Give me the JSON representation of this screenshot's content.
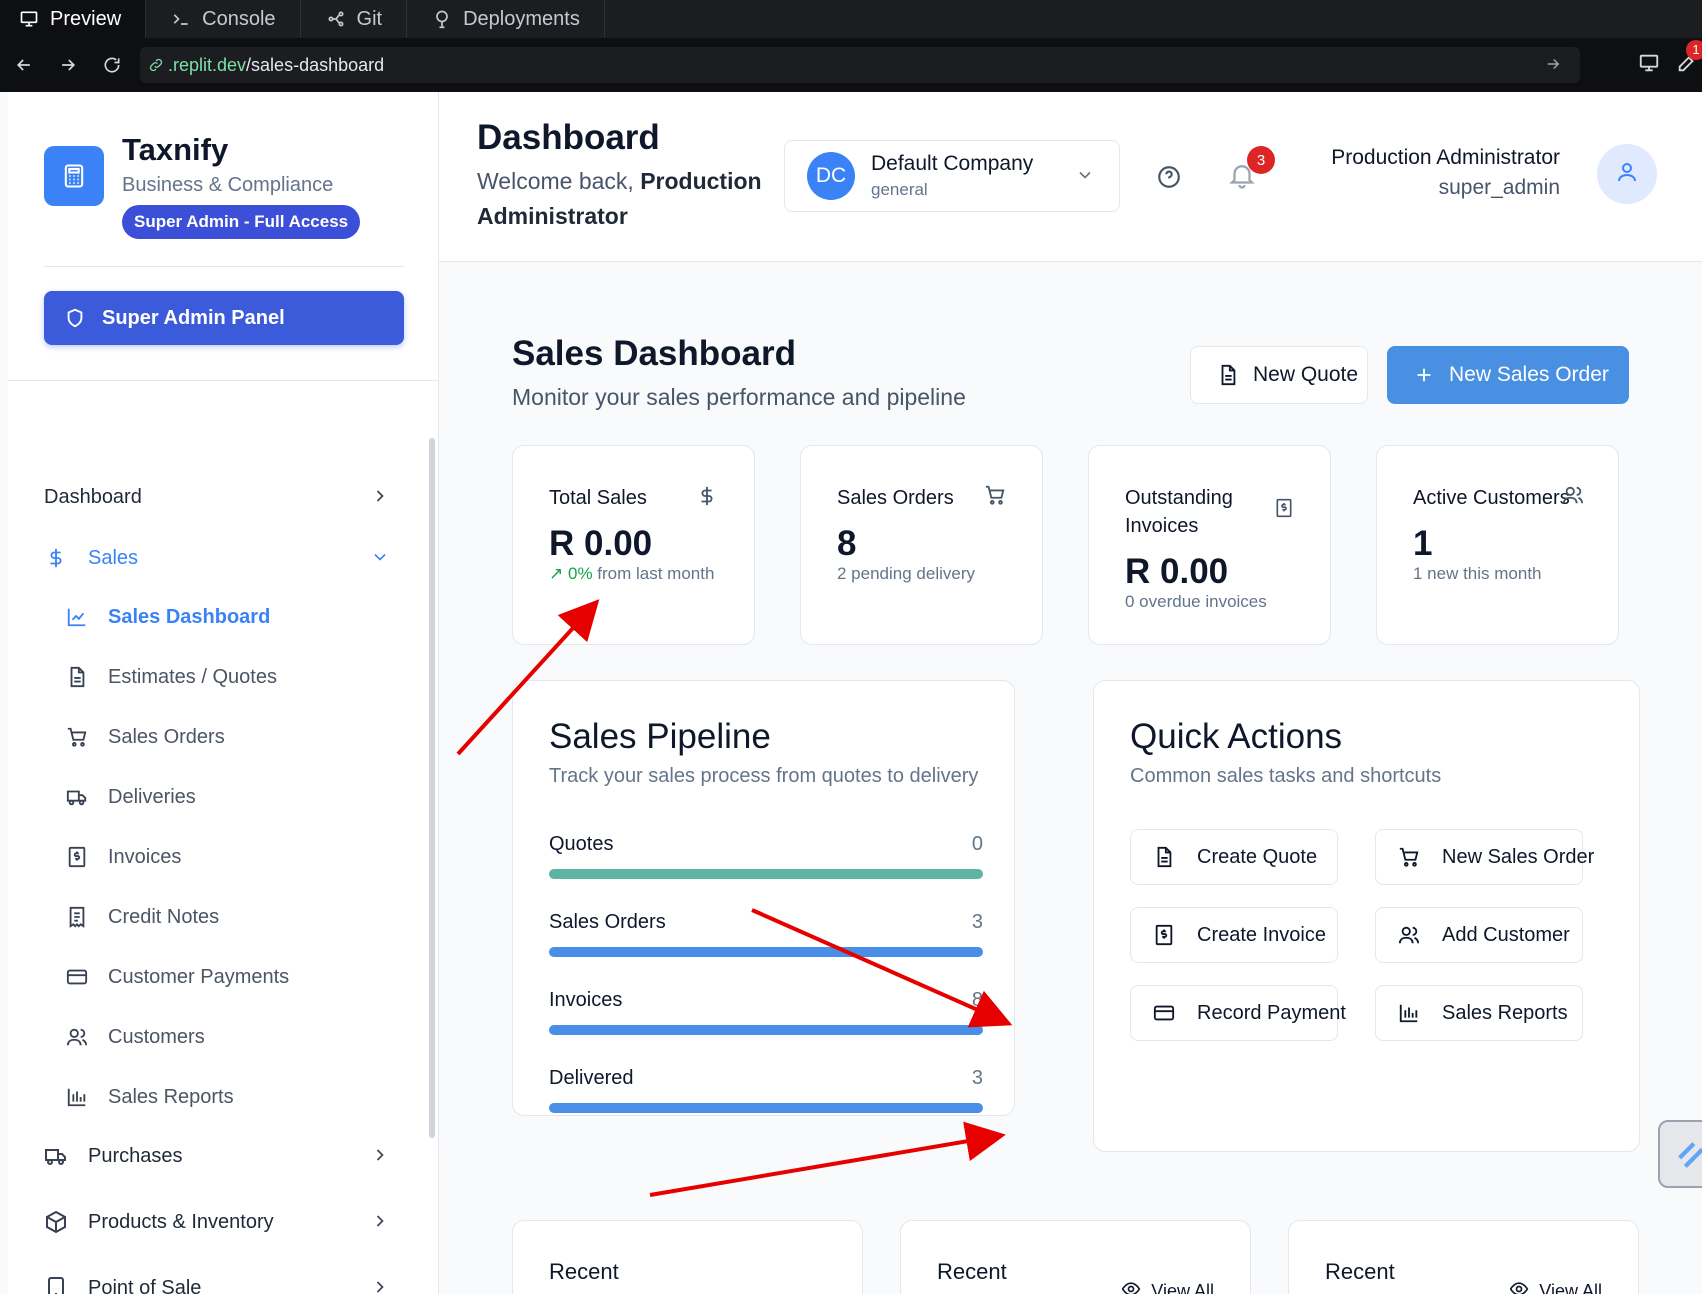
{
  "browser": {
    "tabs": [
      {
        "label": "Preview",
        "icon": "monitor-icon"
      },
      {
        "label": "Console",
        "icon": "terminal-icon"
      },
      {
        "label": "Git",
        "icon": "git-icon"
      },
      {
        "label": "Deployments",
        "icon": "deployments-icon"
      }
    ],
    "url_domain": ".replit.dev",
    "url_path": "/sales-dashboard",
    "notification_count": "1"
  },
  "sidebar": {
    "brand_title": "Taxnify",
    "brand_subtitle": "Business & Compliance",
    "access_badge": "Super Admin - Full Access",
    "admin_panel_label": "Super Admin Panel",
    "nav": [
      {
        "label": "Dashboard",
        "expanded": false
      },
      {
        "label": "Sales",
        "expanded": true
      },
      {
        "label": "Purchases",
        "expanded": false
      },
      {
        "label": "Products & Inventory",
        "expanded": false
      },
      {
        "label": "Point of Sale",
        "expanded": false
      }
    ],
    "sales_items": [
      {
        "label": "Sales Dashboard",
        "icon": "line-chart-icon",
        "active": true
      },
      {
        "label": "Estimates / Quotes",
        "icon": "document-icon"
      },
      {
        "label": "Sales Orders",
        "icon": "cart-icon"
      },
      {
        "label": "Deliveries",
        "icon": "truck-icon"
      },
      {
        "label": "Invoices",
        "icon": "invoice-icon"
      },
      {
        "label": "Credit Notes",
        "icon": "receipt-icon"
      },
      {
        "label": "Customer Payments",
        "icon": "credit-card-icon"
      },
      {
        "label": "Customers",
        "icon": "users-icon"
      },
      {
        "label": "Sales Reports",
        "icon": "bar-chart-icon"
      }
    ]
  },
  "header": {
    "title": "Dashboard",
    "welcome_prefix": "Welcome back, ",
    "welcome_name": "Production Administrator",
    "company_initials": "DC",
    "company_name": "Default Company",
    "company_type": "general",
    "notifications": "3",
    "user_name": "Production Administrator",
    "user_role": "super_admin"
  },
  "main": {
    "title": "Sales Dashboard",
    "subtitle": "Monitor your sales performance and pipeline",
    "new_quote_label": "New Quote",
    "new_order_label": "New Sales Order",
    "stats": [
      {
        "label": "Total Sales",
        "value": "R 0.00",
        "note_prefix": "0%",
        "note": " from last month",
        "icon": "dollar-icon"
      },
      {
        "label": "Sales Orders",
        "value": "8",
        "note": "2 pending delivery",
        "icon": "cart-icon"
      },
      {
        "label": "Outstanding Invoices",
        "value": "R 0.00",
        "note": "0 overdue invoices",
        "icon": "invoice-icon"
      },
      {
        "label": "Active Customers",
        "value": "1",
        "note": "1 new this month",
        "icon": "users-icon"
      }
    ],
    "pipeline": {
      "title": "Sales Pipeline",
      "subtitle": "Track your sales process from quotes to delivery",
      "rows": [
        {
          "label": "Quotes",
          "count": "0",
          "fill": 1.0,
          "color": "#5fb3a3"
        },
        {
          "label": "Sales Orders",
          "count": "3",
          "fill": 1.0,
          "color": "#4a8fe7"
        },
        {
          "label": "Invoices",
          "count": "8",
          "fill": 1.0,
          "color": "#4a8fe7"
        },
        {
          "label": "Delivered",
          "count": "3",
          "fill": 1.0,
          "color": "#4a8fe7"
        }
      ]
    },
    "quick_actions": {
      "title": "Quick Actions",
      "subtitle": "Common sales tasks and shortcuts",
      "buttons": [
        {
          "label": "Create Quote",
          "icon": "document-icon"
        },
        {
          "label": "New Sales Order",
          "icon": "cart-icon"
        },
        {
          "label": "Create Invoice",
          "icon": "invoice-icon"
        },
        {
          "label": "Add Customer",
          "icon": "users-icon"
        },
        {
          "label": "Record Payment",
          "icon": "credit-card-icon"
        },
        {
          "label": "Sales Reports",
          "icon": "bar-chart-icon"
        }
      ]
    },
    "recent": [
      {
        "title": "Recent",
        "view_all": ""
      },
      {
        "title": "Recent",
        "view_all": "View All"
      },
      {
        "title": "Recent",
        "view_all": "View All"
      }
    ]
  },
  "colors": {
    "accent": "#3b82f6",
    "admin_button": "#3b5bdb",
    "annotation_arrow": "#e60000"
  }
}
